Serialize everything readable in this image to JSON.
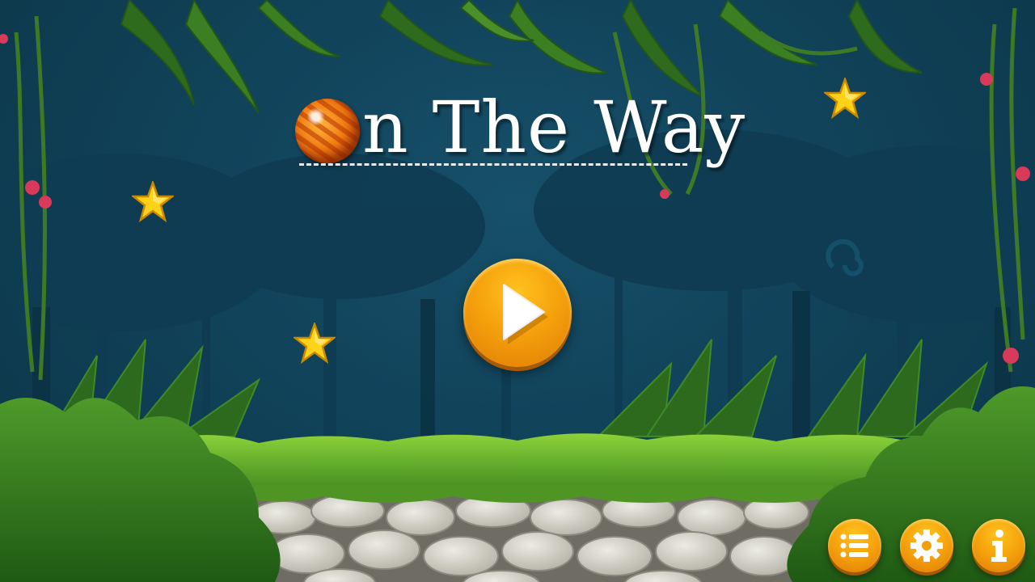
{
  "game": {
    "title_text": "n The Way",
    "title_ball": "orange-ball-icon"
  },
  "menu": {
    "play_icon": "play-icon",
    "levels_icon": "list-icon",
    "settings_icon": "gear-icon",
    "info_icon": "info-icon"
  },
  "decorations": {
    "star_icon": "star-icon",
    "star_count": 3
  },
  "colors": {
    "background": "#11445b",
    "button_orange": "#f5a10c",
    "star_gold": "#ffd21a",
    "grass": "#5ea82a",
    "stone": "#cfccc2"
  }
}
